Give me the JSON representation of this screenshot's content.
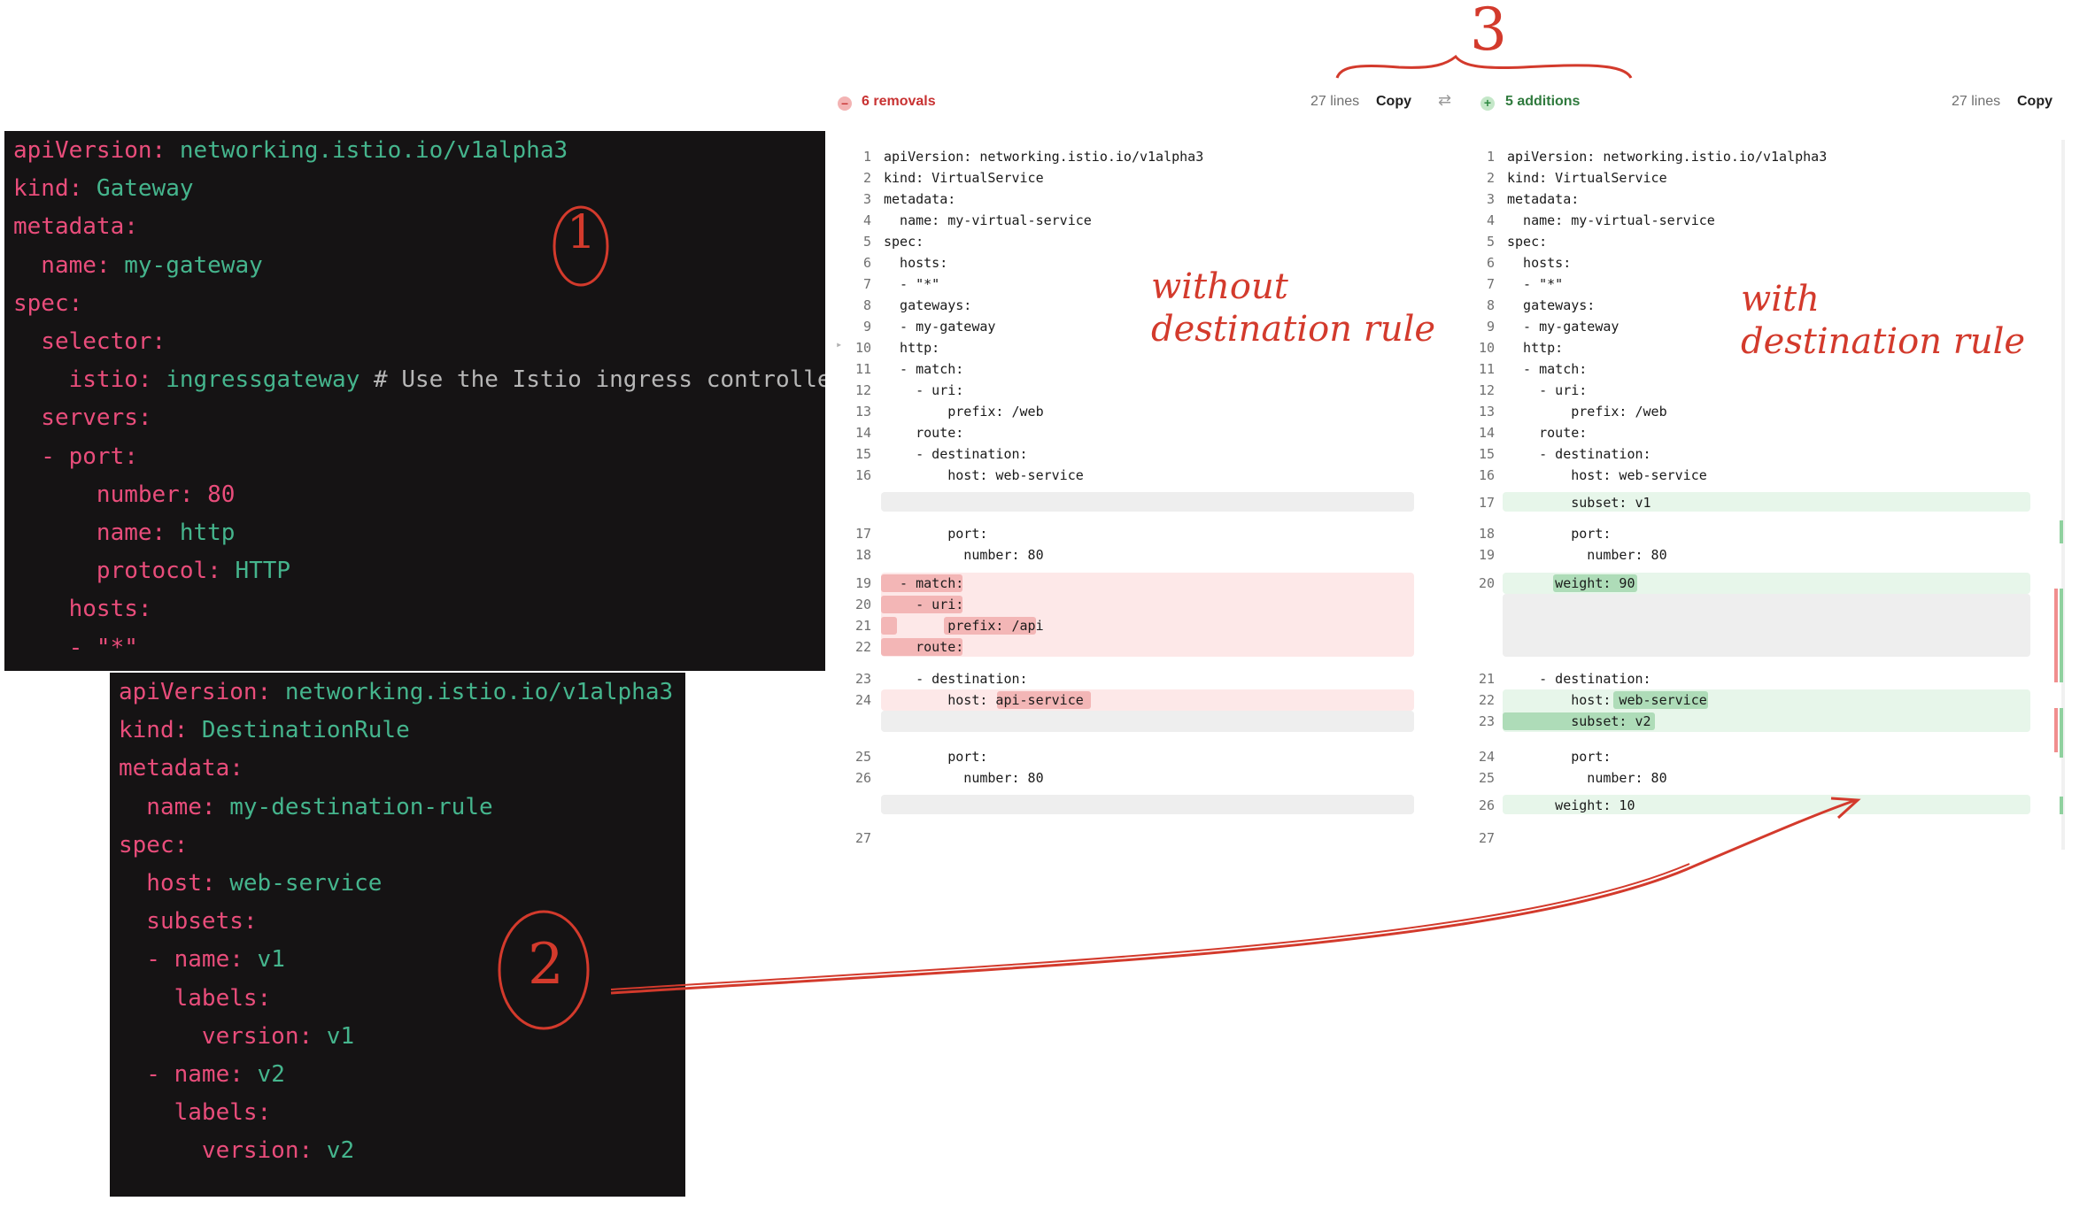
{
  "gateway_yaml": {
    "lines": [
      {
        "k": "apiVersion:",
        "v": " networking.istio.io/v1alpha3"
      },
      {
        "k": "kind:",
        "v": " Gateway"
      },
      {
        "k": "metadata:",
        "v": ""
      },
      {
        "k": "  name:",
        "v": " my-gateway"
      },
      {
        "k": "spec:",
        "v": ""
      },
      {
        "k": "  selector:",
        "v": ""
      },
      {
        "k": "    istio:",
        "v": " ingressgateway",
        "c": " # Use the Istio ingress controller"
      },
      {
        "k": "  servers:",
        "v": ""
      },
      {
        "k": "  - port:",
        "v": ""
      },
      {
        "k": "      number:",
        "v": " 80",
        "vk": true
      },
      {
        "k": "      name:",
        "v": " http"
      },
      {
        "k": "      protocol:",
        "v": " HTTP"
      },
      {
        "k": "    hosts:",
        "v": ""
      },
      {
        "k": "    - ",
        "v": "\"*\"",
        "vk": true
      }
    ]
  },
  "destination_rule_yaml": {
    "lines": [
      {
        "k": "apiVersion:",
        "v": " networking.istio.io/v1alpha3"
      },
      {
        "k": "kind:",
        "v": " DestinationRule"
      },
      {
        "k": "metadata:",
        "v": ""
      },
      {
        "k": "  name:",
        "v": " my-destination-rule"
      },
      {
        "k": "spec:",
        "v": ""
      },
      {
        "k": "  host:",
        "v": " web-service"
      },
      {
        "k": "  subsets:",
        "v": ""
      },
      {
        "k": "  - name:",
        "v": " v1"
      },
      {
        "k": "    labels:",
        "v": ""
      },
      {
        "k": "      version:",
        "v": " v1"
      },
      {
        "k": "  - name:",
        "v": " v2"
      },
      {
        "k": "    labels:",
        "v": ""
      },
      {
        "k": "      version:",
        "v": " v2"
      }
    ]
  },
  "diff": {
    "left_header": {
      "label": "6 removals",
      "lines": "27 lines",
      "copy": "Copy"
    },
    "right_header": {
      "label": "5 additions",
      "lines": "27 lines",
      "copy": "Copy"
    },
    "swap_icon": "swap-arrows-icon",
    "left": [
      {
        "n": "1",
        "t": "apiVersion: networking.istio.io/v1alpha3"
      },
      {
        "n": "2",
        "t": "kind: VirtualService"
      },
      {
        "n": "3",
        "t": "metadata:"
      },
      {
        "n": "4",
        "t": "  name: my-virtual-service"
      },
      {
        "n": "5",
        "t": "spec:"
      },
      {
        "n": "6",
        "t": "  hosts:"
      },
      {
        "n": "7",
        "t": "  - \"*\""
      },
      {
        "n": "8",
        "t": "  gateways:"
      },
      {
        "n": "9",
        "t": "  - my-gateway"
      },
      {
        "n": "10",
        "t": "  http:"
      },
      {
        "n": "11",
        "t": "  - match:"
      },
      {
        "n": "12",
        "t": "    - uri:"
      },
      {
        "n": "13",
        "t": "        prefix: /web"
      },
      {
        "n": "14",
        "t": "    route:"
      },
      {
        "n": "15",
        "t": "    - destination:"
      },
      {
        "n": "16",
        "t": "        host: web-service"
      },
      {
        "n": "17",
        "t": "        port:"
      },
      {
        "n": "18",
        "t": "          number: 80"
      },
      {
        "n": "19",
        "t": "  - match:"
      },
      {
        "n": "20",
        "t": "    - uri:"
      },
      {
        "n": "21",
        "t": "        prefix: /api"
      },
      {
        "n": "22",
        "t": "    route:"
      },
      {
        "n": "23",
        "t": "    - destination:"
      },
      {
        "n": "24",
        "t": "        host: api-service"
      },
      {
        "n": "25",
        "t": "        port:"
      },
      {
        "n": "26",
        "t": "          number: 80"
      },
      {
        "n": "27",
        "t": ""
      }
    ],
    "right": [
      {
        "n": "1",
        "t": "apiVersion: networking.istio.io/v1alpha3"
      },
      {
        "n": "2",
        "t": "kind: VirtualService"
      },
      {
        "n": "3",
        "t": "metadata:"
      },
      {
        "n": "4",
        "t": "  name: my-virtual-service"
      },
      {
        "n": "5",
        "t": "spec:"
      },
      {
        "n": "6",
        "t": "  hosts:"
      },
      {
        "n": "7",
        "t": "  - \"*\""
      },
      {
        "n": "8",
        "t": "  gateways:"
      },
      {
        "n": "9",
        "t": "  - my-gateway"
      },
      {
        "n": "10",
        "t": "  http:"
      },
      {
        "n": "11",
        "t": "  - match:"
      },
      {
        "n": "12",
        "t": "    - uri:"
      },
      {
        "n": "13",
        "t": "        prefix: /web"
      },
      {
        "n": "14",
        "t": "    route:"
      },
      {
        "n": "15",
        "t": "    - destination:"
      },
      {
        "n": "16",
        "t": "        host: web-service"
      },
      {
        "n": "17",
        "t": "        subset: v1"
      },
      {
        "n": "18",
        "t": "        port:"
      },
      {
        "n": "19",
        "t": "          number: 80"
      },
      {
        "n": "20",
        "t": "      weight: 90"
      },
      {
        "n": "21",
        "t": "    - destination:"
      },
      {
        "n": "22",
        "t": "        host: web-service"
      },
      {
        "n": "23",
        "t": "        subset: v2"
      },
      {
        "n": "24",
        "t": "        port:"
      },
      {
        "n": "25",
        "t": "          number: 80"
      },
      {
        "n": "26",
        "t": "      weight: 10"
      },
      {
        "n": "27",
        "t": ""
      }
    ]
  },
  "annotations": {
    "without": "without\ndestination rule",
    "with": "with\ndestination rule",
    "num1": "1",
    "num2": "2",
    "num3": "3"
  },
  "colors": {
    "annotation": "#d33a2c",
    "yaml_key": "#e94d7b",
    "yaml_value": "#45b58d",
    "removal": "#c83232",
    "addition": "#2f7a3d"
  }
}
